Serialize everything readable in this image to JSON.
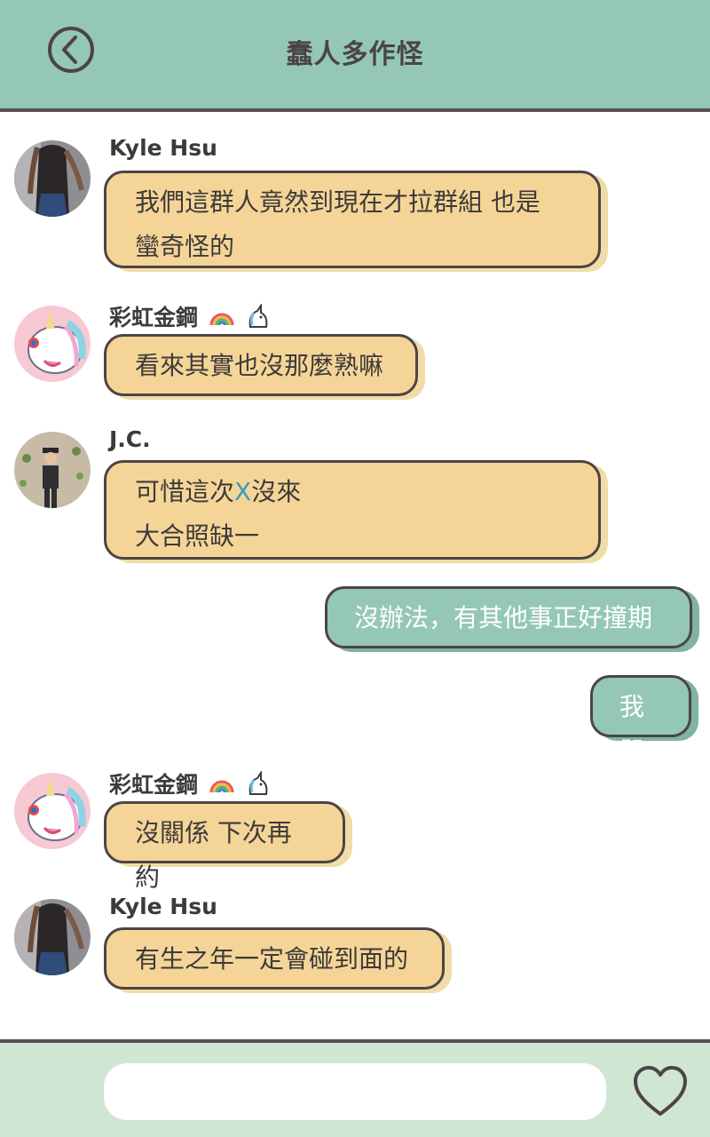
{
  "header": {
    "title": "蠢人多作怪"
  },
  "messages": [
    {
      "sender": "Kyle Hsu",
      "lines": [
        "我們這群人竟然到現在才拉群組 也是",
        "蠻奇怪的"
      ]
    },
    {
      "sender": "彩虹金鋼",
      "emoji": [
        "rainbow-emoji",
        "unicorn-emoji"
      ],
      "lines": [
        "看來其實也沒那麼熟嘛"
      ]
    },
    {
      "sender": "J.C.",
      "lines": [
        "可惜這次",
        "X",
        "沒來",
        "大合照缺一"
      ]
    },
    {
      "sender": "me",
      "lines": [
        "沒辦法，有其他事正好撞期"
      ]
    },
    {
      "sender": "me",
      "lines": [
        "我哭"
      ]
    },
    {
      "sender": "彩虹金鋼",
      "emoji": [
        "rainbow-emoji",
        "unicorn-emoji"
      ],
      "lines": [
        "沒關係 下次再約"
      ]
    },
    {
      "sender": "Kyle Hsu",
      "lines": [
        "有生之年一定會碰到面的"
      ]
    }
  ],
  "footer": {
    "input_placeholder": "",
    "heart_icon": "heart-icon"
  },
  "colors": {
    "header": "#95c7b6",
    "footer": "#cfe6d3",
    "bubble_left": "#f5d597",
    "bubble_right": "#95c7b6",
    "accent_x": "#3a9db8",
    "outline": "#4d4446"
  }
}
